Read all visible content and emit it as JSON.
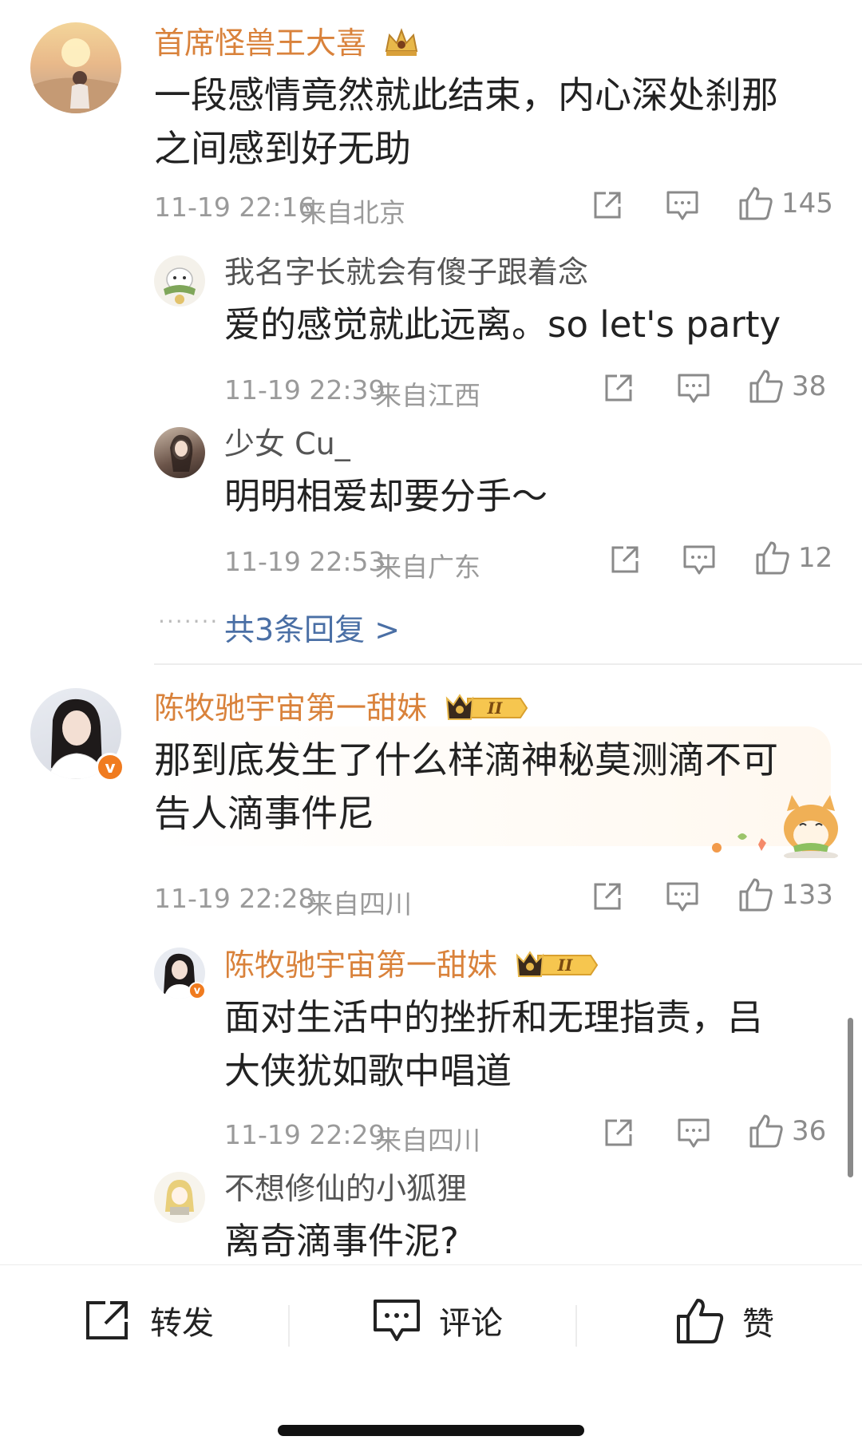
{
  "comments": [
    {
      "user": "首席怪兽王大喜",
      "text": "一段感情竟然就此结束，内心深处刹那\n之间感到好无助",
      "time": "11-19 22:16",
      "location": "来自北京",
      "likes": "145",
      "replies": [
        {
          "user": "我名字长就会有傻子跟着念",
          "text": "爱的感觉就此远离。so let's party",
          "time": "11-19 22:39",
          "location": "来自江西",
          "likes": "38"
        },
        {
          "user": "少女 Cu_",
          "text": "明明相爱却要分手～",
          "time": "11-19 22:53",
          "location": "来自广东",
          "likes": "12"
        }
      ],
      "more_replies": "共3条回复 >"
    },
    {
      "user": "陈牧驰宇宙第一甜妹",
      "level_badge": "II",
      "text": "那到底发生了什么样滴神秘莫测滴不可\n告人滴事件尼",
      "time": "11-19 22:28",
      "location": "来自四川",
      "likes": "133",
      "replies": [
        {
          "user": "陈牧驰宇宙第一甜妹",
          "level_badge": "II",
          "text": "面对生活中的挫折和无理指责，吕\n大侠犹如歌中唱道",
          "time": "11-19 22:29",
          "location": "来自四川",
          "likes": "36"
        },
        {
          "user": "不想修仙的小狐狸",
          "text": "离奇滴事件泥?"
        }
      ]
    }
  ],
  "bottom_bar": {
    "repost_label": "转发",
    "comment_label": "评论",
    "like_label": "赞"
  },
  "colors": {
    "username_gold": "#d9823b",
    "link_blue": "#4a6fa5",
    "meta_gray": "#9a9a9a",
    "verified_orange": "#f07b1f"
  }
}
